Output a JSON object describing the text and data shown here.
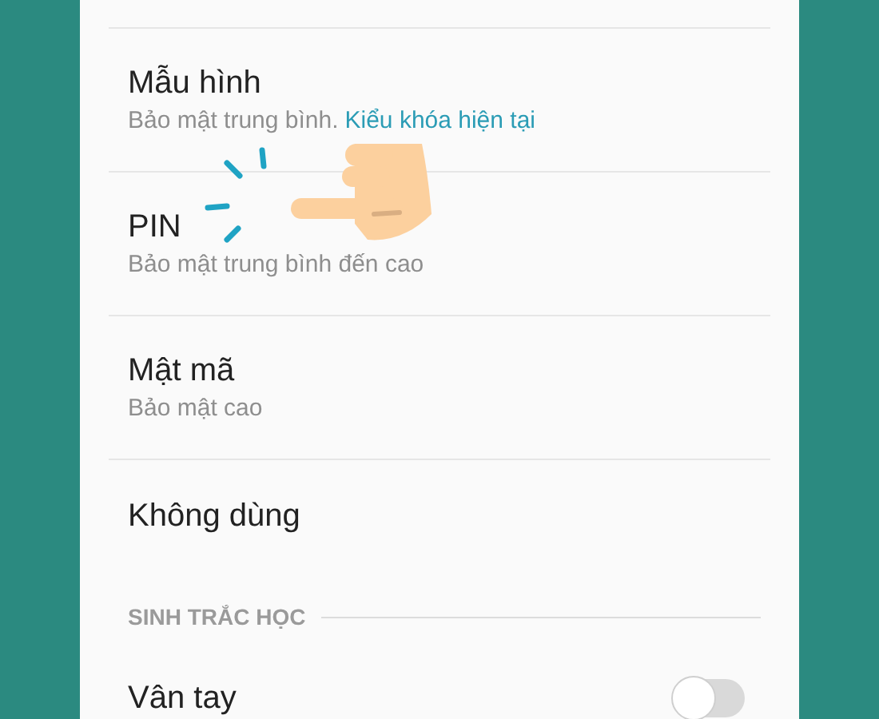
{
  "options": [
    {
      "title": "Mẫu hình",
      "subtitle": "Bảo mật trung bình.",
      "status": "Kiểu khóa hiện tại"
    },
    {
      "title": "PIN",
      "subtitle": "Bảo mật trung bình đến cao"
    },
    {
      "title": "Mật mã",
      "subtitle": "Bảo mật cao"
    },
    {
      "title": "Không dùng"
    }
  ],
  "section": {
    "title": "SINH TRẮC HỌC",
    "items": [
      {
        "title": "Vân tay",
        "kind": "toggle",
        "on": false
      }
    ]
  }
}
